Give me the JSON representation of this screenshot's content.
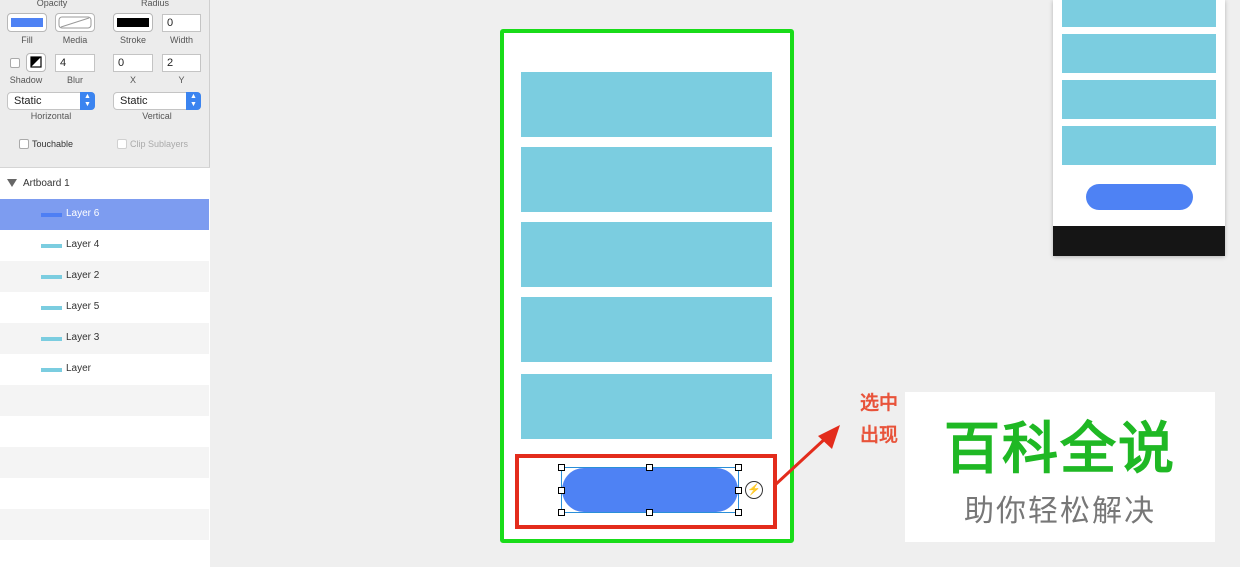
{
  "inspector": {
    "opacity_label": "Opacity",
    "radius_label": "Radius",
    "fill_label": "Fill",
    "media_label": "Media",
    "stroke_label": "Stroke",
    "width_label": "Width",
    "width_value": "0",
    "shadow_label": "Shadow",
    "blur_label": "Blur",
    "blur_value": "4",
    "x_label": "X",
    "x_value": "0",
    "y_label": "Y",
    "y_value": "2",
    "horizontal_value": "Static",
    "horizontal_label": "Horizontal",
    "vertical_value": "Static",
    "vertical_label": "Vertical",
    "touchable_label": "Touchable",
    "clip_label": "Clip Sublayers",
    "fill_color": "#4e82f4",
    "stroke_color": "#000000"
  },
  "layers": {
    "group_label": "Artboard 1",
    "items": [
      {
        "label": "Layer 6",
        "selected": true
      },
      {
        "label": "Layer 4",
        "selected": false
      },
      {
        "label": "Layer 2",
        "selected": false
      },
      {
        "label": "Layer 5",
        "selected": false
      },
      {
        "label": "Layer 3",
        "selected": false
      },
      {
        "label": "Layer",
        "selected": false
      }
    ]
  },
  "canvas": {
    "artboard_border_color": "#19dc19",
    "card_color": "#7bcde0",
    "button_color": "#4e82f4",
    "highlight_color": "#e32c1c",
    "bolt_icon": "⚡"
  },
  "annotation": {
    "line1": "选中",
    "line2": "出现"
  },
  "watermark": {
    "title": "百科全说",
    "subtitle": "助你轻松解决"
  }
}
